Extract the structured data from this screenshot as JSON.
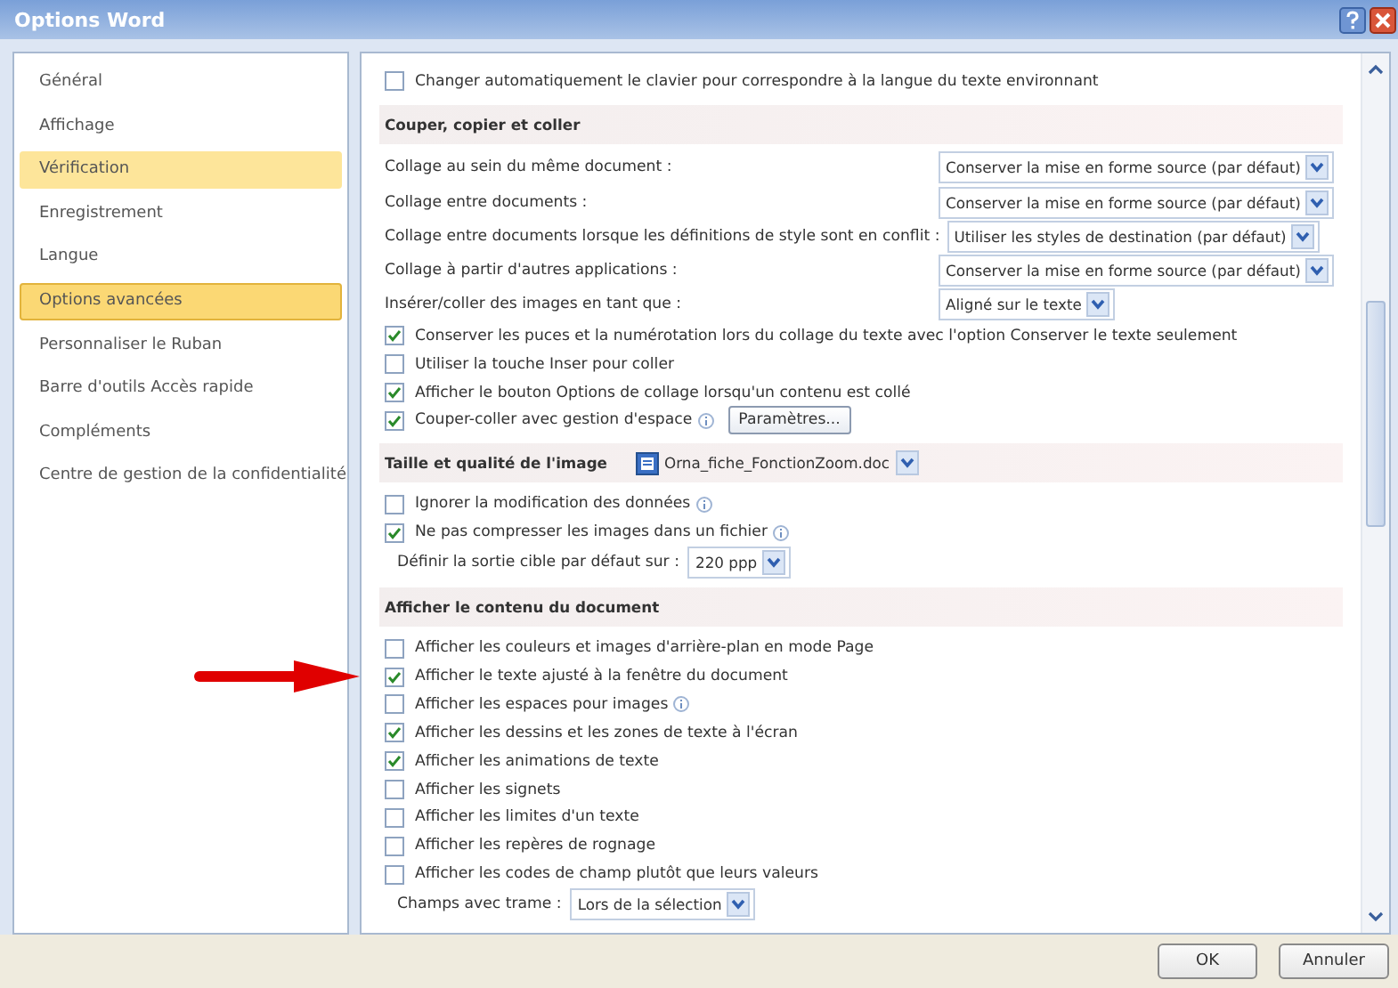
{
  "window": {
    "title": "Options Word"
  },
  "sidebar": {
    "items": [
      {
        "label": "Général",
        "selected": false,
        "hovered": false
      },
      {
        "label": "Affichage",
        "selected": false,
        "hovered": false
      },
      {
        "label": "Vérification",
        "selected": false,
        "hovered": true
      },
      {
        "label": "Enregistrement",
        "selected": false,
        "hovered": false
      },
      {
        "label": "Langue",
        "selected": false,
        "hovered": false
      },
      {
        "label": "Options avancées",
        "selected": true,
        "hovered": false
      },
      {
        "label": "Personnaliser le Ruban",
        "selected": false,
        "hovered": false
      },
      {
        "label": "Barre d'outils Accès rapide",
        "selected": false,
        "hovered": false
      },
      {
        "label": "Compléments",
        "selected": false,
        "hovered": false
      },
      {
        "label": "Centre de gestion de la confidentialité",
        "selected": false,
        "hovered": false
      }
    ]
  },
  "content": {
    "rows": [
      {
        "kind": "checkbox",
        "label": "Changer automatiquement le clavier pour correspondre à la langue du texte environnant",
        "checked": false
      },
      {
        "kind": "section",
        "title": "Couper, copier et coller"
      },
      {
        "kind": "select",
        "label": "Collage au sein du même document :",
        "value": "Conserver la mise en forme source (par défaut)"
      },
      {
        "kind": "select",
        "label": "Collage entre documents :",
        "value": "Conserver la mise en forme source (par défaut)"
      },
      {
        "kind": "select",
        "label": "Collage entre documents lorsque les définitions de style sont en conflit :",
        "value": "Utiliser les styles de destination (par défaut)"
      },
      {
        "kind": "select",
        "label": "Collage à partir d'autres applications :",
        "value": "Conserver la mise en forme source (par défaut)"
      },
      {
        "kind": "select",
        "label": "Insérer/coller des images en tant que :",
        "value": "Aligné sur le texte"
      },
      {
        "kind": "checkbox",
        "label": "Conserver les puces et la numérotation lors du collage du texte avec l'option Conserver le texte seulement",
        "checked": true
      },
      {
        "kind": "checkbox",
        "label": "Utiliser la touche Inser pour coller",
        "checked": false
      },
      {
        "kind": "checkbox",
        "label": "Afficher le bouton Options de collage lorsqu'un contenu est collé",
        "checked": true
      },
      {
        "kind": "checkbox",
        "label": "Couper-coller avec gestion d'espace",
        "checked": true,
        "info": true,
        "button": "Paramètres..."
      },
      {
        "kind": "section",
        "title": "Taille et qualité de l'image",
        "file": "Orna_fiche_FonctionZoom.doc"
      },
      {
        "kind": "checkbox",
        "label": "Ignorer la modification des données",
        "checked": false,
        "info": true
      },
      {
        "kind": "checkbox",
        "label": "Ne pas compresser les images dans un fichier",
        "checked": true,
        "info": true
      },
      {
        "kind": "inline_select",
        "label": "Définir la sortie cible par défaut sur :",
        "value": "220 ppp"
      },
      {
        "kind": "section",
        "title": "Afficher le contenu du document"
      },
      {
        "kind": "checkbox",
        "label": "Afficher les couleurs et images d'arrière-plan en mode Page",
        "checked": false
      },
      {
        "kind": "checkbox",
        "label": "Afficher le texte ajusté à la fenêtre du document",
        "checked": true,
        "pointer": true
      },
      {
        "kind": "checkbox",
        "label": "Afficher les espaces pour images",
        "checked": false,
        "info": true
      },
      {
        "kind": "checkbox",
        "label": "Afficher les dessins et les zones de texte à l'écran",
        "checked": true
      },
      {
        "kind": "checkbox",
        "label": "Afficher les animations de texte",
        "checked": true
      },
      {
        "kind": "checkbox",
        "label": "Afficher les signets",
        "checked": false
      },
      {
        "kind": "checkbox",
        "label": "Afficher les limites d'un texte",
        "checked": false
      },
      {
        "kind": "checkbox",
        "label": "Afficher les repères de rognage",
        "checked": false
      },
      {
        "kind": "checkbox",
        "label": "Afficher les codes de champ plutôt que leurs valeurs",
        "checked": false
      },
      {
        "kind": "inline_select",
        "label": "Champs avec trame :",
        "value": "Lors de la sélection"
      }
    ]
  },
  "buttons": [
    {
      "label": "OK",
      "kind": "ok"
    },
    {
      "label": "Annuler",
      "kind": "cancel"
    }
  ]
}
